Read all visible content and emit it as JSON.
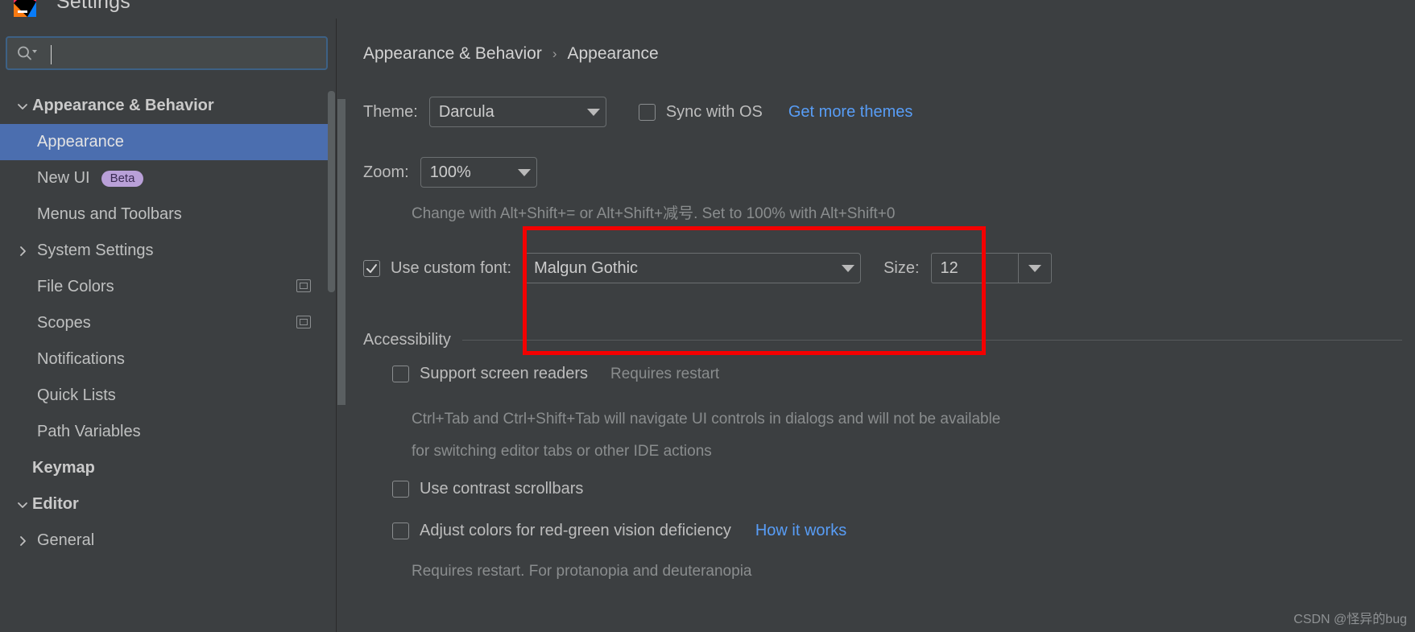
{
  "window": {
    "title": "Settings",
    "logo_icon": "intellij-idea-logo-icon"
  },
  "sidebar": {
    "search": {
      "placeholder": "",
      "value": "",
      "icon": "search-icon"
    },
    "items": [
      {
        "label": "Appearance & Behavior",
        "level": 0,
        "bold": true,
        "arrow": "chevron-down",
        "selected": false,
        "badge": "",
        "right_icon": ""
      },
      {
        "label": "Appearance",
        "level": 1,
        "bold": false,
        "arrow": "",
        "selected": true,
        "badge": "",
        "right_icon": ""
      },
      {
        "label": "New UI",
        "level": 1,
        "bold": false,
        "arrow": "",
        "selected": false,
        "badge": "Beta",
        "right_icon": ""
      },
      {
        "label": "Menus and Toolbars",
        "level": 1,
        "bold": false,
        "arrow": "",
        "selected": false,
        "badge": "",
        "right_icon": ""
      },
      {
        "label": "System Settings",
        "level": 1,
        "bold": false,
        "arrow": "chevron-right",
        "selected": false,
        "badge": "",
        "right_icon": ""
      },
      {
        "label": "File Colors",
        "level": 1,
        "bold": false,
        "arrow": "",
        "selected": false,
        "badge": "",
        "right_icon": "copy-icon"
      },
      {
        "label": "Scopes",
        "level": 1,
        "bold": false,
        "arrow": "",
        "selected": false,
        "badge": "",
        "right_icon": "copy-icon"
      },
      {
        "label": "Notifications",
        "level": 1,
        "bold": false,
        "arrow": "",
        "selected": false,
        "badge": "",
        "right_icon": ""
      },
      {
        "label": "Quick Lists",
        "level": 1,
        "bold": false,
        "arrow": "",
        "selected": false,
        "badge": "",
        "right_icon": ""
      },
      {
        "label": "Path Variables",
        "level": 1,
        "bold": false,
        "arrow": "",
        "selected": false,
        "badge": "",
        "right_icon": ""
      },
      {
        "label": "Keymap",
        "level": 0,
        "bold": true,
        "arrow": "",
        "selected": false,
        "badge": "",
        "right_icon": ""
      },
      {
        "label": "Editor",
        "level": 0,
        "bold": true,
        "arrow": "chevron-down",
        "selected": false,
        "badge": "",
        "right_icon": ""
      },
      {
        "label": "General",
        "level": 1,
        "bold": false,
        "arrow": "chevron-right",
        "selected": false,
        "badge": "",
        "right_icon": ""
      }
    ]
  },
  "breadcrumb": {
    "parent": "Appearance & Behavior",
    "separator": "›",
    "current": "Appearance"
  },
  "appearance": {
    "theme_label": "Theme:",
    "theme_value": "Darcula",
    "sync_with_os_label": "Sync with OS",
    "sync_with_os_checked": false,
    "get_more_themes_label": "Get more themes",
    "zoom_label": "Zoom:",
    "zoom_value": "100%",
    "zoom_hint": "Change with Alt+Shift+= or Alt+Shift+减号. Set to 100% with Alt+Shift+0",
    "use_custom_font_label": "Use custom font:",
    "use_custom_font_checked": true,
    "custom_font_value": "Malgun Gothic",
    "size_label": "Size:",
    "size_value": "12"
  },
  "accessibility": {
    "section_title": "Accessibility",
    "support_screen_readers_label": "Support screen readers",
    "support_screen_readers_checked": false,
    "requires_restart_note": "Requires restart",
    "screen_readers_hint_line1": "Ctrl+Tab and Ctrl+Shift+Tab will navigate UI controls in dialogs and will not be available",
    "screen_readers_hint_line2": "for switching editor tabs or other IDE actions",
    "use_contrast_scrollbars_label": "Use contrast scrollbars",
    "use_contrast_scrollbars_checked": false,
    "adjust_colors_label": "Adjust colors for red-green vision deficiency",
    "adjust_colors_checked": false,
    "how_it_works_label": "How it works",
    "protanopia_note": "Requires restart. For protanopia and deuteranopia"
  },
  "watermark": "CSDN @怪异的bug",
  "colors": {
    "accent_selection": "#4b6eaf",
    "link": "#589df6",
    "annotation": "#f40000",
    "badge_beta_bg": "#b9a0d8",
    "panel_bg": "#3c3f41"
  }
}
